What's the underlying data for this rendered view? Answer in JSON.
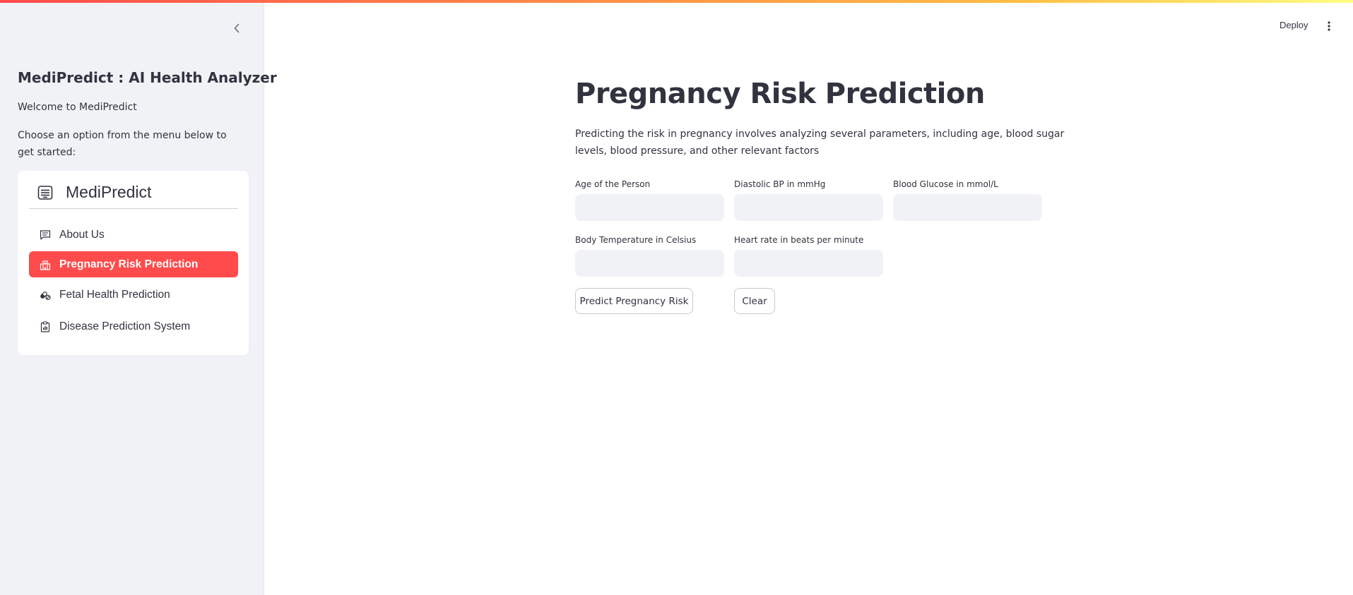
{
  "colors": {
    "accent": "#ff4b4b",
    "sidebar_bg": "#f0f2f6",
    "input_bg": "#f0f2f6",
    "text": "#31333f"
  },
  "sidebar": {
    "collapse_icon": "chevron-left-icon",
    "title": "MediPredict : AI Health Analyzer",
    "welcome": "Welcome to MediPredict",
    "instruction": "Choose an option from the menu below to get started:",
    "menu": {
      "header_icon": "list-icon",
      "header": "MediPredict",
      "selected": "Pregnancy Risk Prediction",
      "items": [
        {
          "label": "About Us",
          "icon": "chat-icon"
        },
        {
          "label": "Pregnancy Risk Prediction",
          "icon": "hospital-icon"
        },
        {
          "label": "Fetal Health Prediction",
          "icon": "capsule-icon"
        },
        {
          "label": "Disease Prediction System",
          "icon": "clipboard-icon"
        }
      ]
    }
  },
  "header": {
    "deploy_label": "Deploy",
    "menu_icon": "vertical-dots-icon"
  },
  "main": {
    "title": "Pregnancy Risk Prediction",
    "description": "Predicting the risk in pregnancy involves analyzing several parameters, including age, blood sugar levels, blood pressure, and other relevant factors",
    "fields": [
      {
        "label": "Age of the Person",
        "value": ""
      },
      {
        "label": "Diastolic BP in mmHg",
        "value": ""
      },
      {
        "label": "Blood Glucose in mmol/L",
        "value": ""
      },
      {
        "label": "Body Temperature in Celsius",
        "value": ""
      },
      {
        "label": "Heart rate in beats per minute",
        "value": ""
      }
    ],
    "predict_button": "Predict Pregnancy Risk",
    "clear_button": "Clear"
  }
}
